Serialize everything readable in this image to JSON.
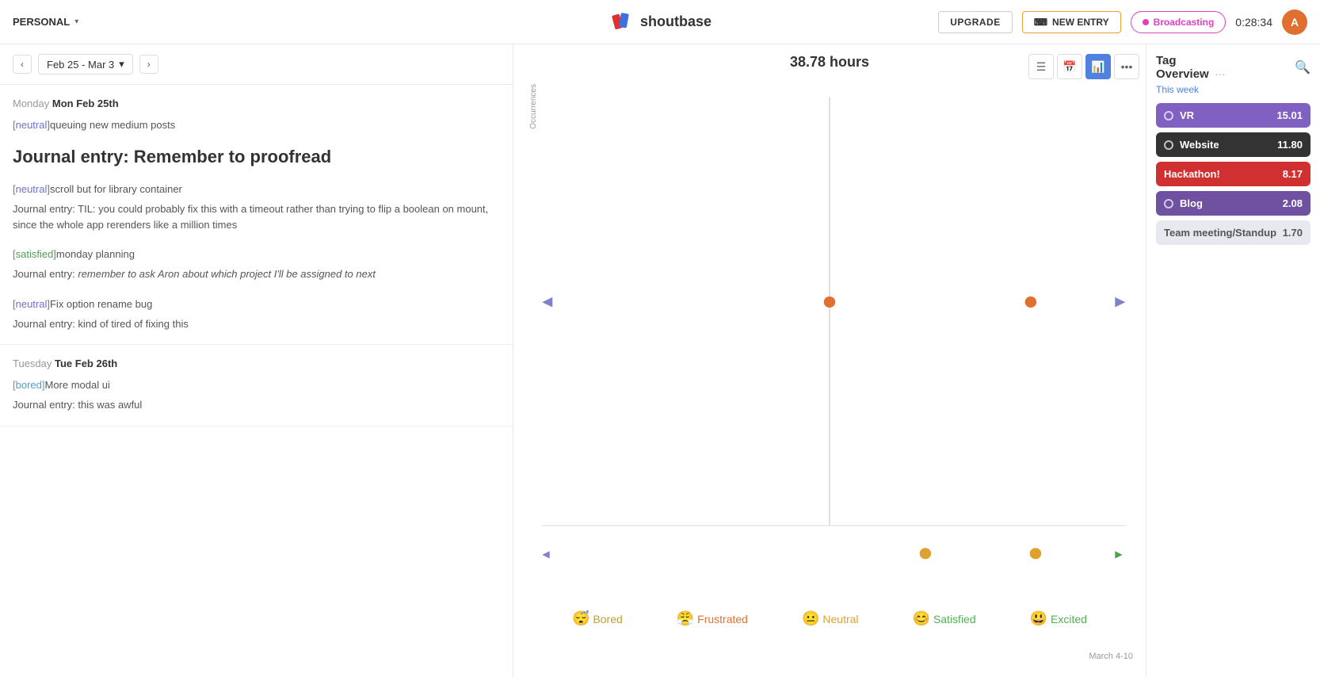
{
  "nav": {
    "workspace": "PERSONAL",
    "brand": "shoutbase",
    "upgrade_label": "UPGRADE",
    "new_entry_label": "NEW ENTRY",
    "broadcasting_label": "Broadcasting",
    "timer": "0:28:34",
    "avatar_initial": "A"
  },
  "week": {
    "range": "Feb 25 - Mar 3",
    "hours_title": "38.78 hours"
  },
  "days": [
    {
      "day_label": "Monday",
      "day_strong": "Mon Feb 25th",
      "entries": [
        {
          "tag": "neutral",
          "tag_class": "neutral",
          "text": "queuing new medium posts",
          "is_title": false,
          "journal": null
        },
        {
          "tag": null,
          "text": "Journal entry: Remember to proofread",
          "is_title": true,
          "journal": null
        },
        {
          "tag": "neutral",
          "tag_class": "neutral",
          "text": "scroll but for library container",
          "is_title": false,
          "journal": "Journal entry: TIL: you could probably fix this with a timeout rather than trying to flip a boolean on mount, since the whole app rerenders like a million times"
        },
        {
          "tag": "satisfied",
          "tag_class": "satisfied",
          "text": "monday planning",
          "is_title": false,
          "journal": "Journal entry: remember to ask Aron about which project I'll be assigned to next",
          "journal_italic": true
        },
        {
          "tag": "neutral",
          "tag_class": "neutral",
          "text": "Fix option rename bug",
          "is_title": false,
          "journal": "Journal entry: kind of tired of fixing this"
        }
      ]
    },
    {
      "day_label": "Tuesday",
      "day_strong": "Tue Feb 26th",
      "entries": [
        {
          "tag": "bored",
          "tag_class": "bored",
          "text": "More modal ui",
          "is_title": false,
          "journal": "Journal entry: this was awful"
        }
      ]
    }
  ],
  "chart": {
    "occurrences_label": "Occurrences",
    "march_label": "March 4-10"
  },
  "moods": [
    {
      "emoji": "😴",
      "label": "Bored",
      "class": "mood-bored"
    },
    {
      "emoji": "😤",
      "label": "Frustrated",
      "class": "mood-frustrated"
    },
    {
      "emoji": "😐",
      "label": "Neutral",
      "class": "mood-neutral"
    },
    {
      "emoji": "😊",
      "label": "Satisfied",
      "class": "mood-satisfied"
    },
    {
      "emoji": "😃",
      "label": "Excited",
      "class": "mood-excited"
    }
  ],
  "sidebar": {
    "title": "Tag",
    "subtitle": "Overview",
    "this_week": "This week",
    "tags": [
      {
        "name": "VR",
        "hours": "15.01",
        "class": "tag-vr",
        "dot_style": "outline"
      },
      {
        "name": "Website",
        "hours": "11.80",
        "class": "tag-website",
        "dot_style": "outline"
      },
      {
        "name": "Hackathon!",
        "hours": "8.17",
        "class": "tag-hackathon",
        "dot_style": "solid"
      },
      {
        "name": "Blog",
        "hours": "2.08",
        "class": "tag-blog",
        "dot_style": "outline"
      },
      {
        "name": "Team meeting/Standup",
        "hours": "1.70",
        "class": "tag-meeting",
        "dot_style": "none"
      }
    ]
  }
}
